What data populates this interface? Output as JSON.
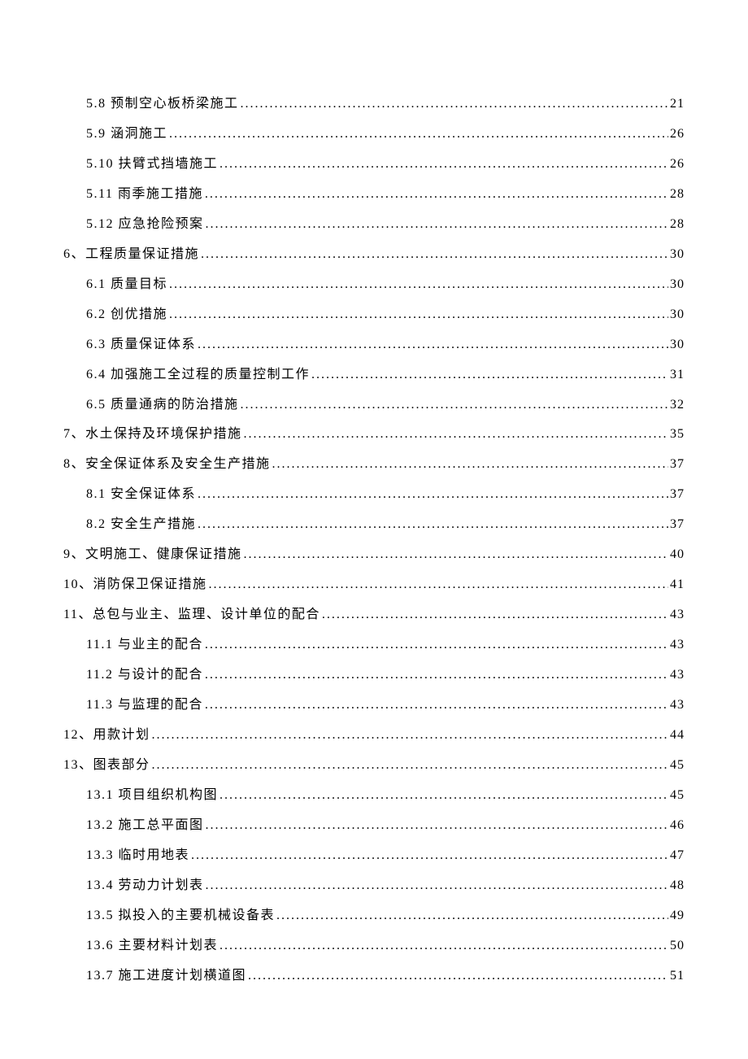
{
  "toc": [
    {
      "level": 2,
      "label": "5.8 预制空心板桥梁施工 ",
      "page": "21"
    },
    {
      "level": 2,
      "label": "5.9 涵洞施工 ",
      "page": "26"
    },
    {
      "level": 2,
      "label": "5.10 扶臂式挡墙施工 ",
      "page": "26"
    },
    {
      "level": 2,
      "label": "5.11 雨季施工措施 ",
      "page": "28"
    },
    {
      "level": 2,
      "label": "5.12 应急抢险预案 ",
      "page": "28"
    },
    {
      "level": 1,
      "label": "6、工程质量保证措施",
      "page": "30"
    },
    {
      "level": 2,
      "label": "6.1 质量目标 ",
      "page": "30"
    },
    {
      "level": 2,
      "label": "6.2 创优措施 ",
      "page": "30"
    },
    {
      "level": 2,
      "label": "6.3 质量保证体系 ",
      "page": "30"
    },
    {
      "level": 2,
      "label": "6.4 加强施工全过程的质量控制工作 ",
      "page": "31"
    },
    {
      "level": 2,
      "label": "6.5 质量通病的防治措施 ",
      "page": "32"
    },
    {
      "level": 1,
      "label": "7、水土保持及环境保护措施",
      "page": "35"
    },
    {
      "level": 1,
      "label": "8、安全保证体系及安全生产措施",
      "page": "37"
    },
    {
      "level": 2,
      "label": "8.1 安全保证体系 ",
      "page": "37"
    },
    {
      "level": 2,
      "label": "8.2 安全生产措施 ",
      "page": "37"
    },
    {
      "level": 1,
      "label": "9、文明施工、健康保证措施",
      "page": "40"
    },
    {
      "level": 1,
      "label": "10、消防保卫保证措施",
      "page": "41"
    },
    {
      "level": 1,
      "label": "11、总包与业主、监理、设计单位的配合",
      "page": "43"
    },
    {
      "level": 2,
      "label": "11.1 与业主的配合 ",
      "page": "43"
    },
    {
      "level": 2,
      "label": "11.2 与设计的配合 ",
      "page": "43"
    },
    {
      "level": 2,
      "label": "11.3  与监理的配合",
      "page": "43"
    },
    {
      "level": 1,
      "label": "12、用款计划",
      "page": "44"
    },
    {
      "level": 1,
      "label": "13、图表部分",
      "page": "45"
    },
    {
      "level": 2,
      "label": "13.1 项目组织机构图 ",
      "page": "45"
    },
    {
      "level": 2,
      "label": "13.2 施工总平面图 ",
      "page": "46"
    },
    {
      "level": 2,
      "label": "13.3 临时用地表 ",
      "page": "47"
    },
    {
      "level": 2,
      "label": "13.4 劳动力计划表 ",
      "page": "48"
    },
    {
      "level": 2,
      "label": "13.5 拟投入的主要机械设备表 ",
      "page": "49"
    },
    {
      "level": 2,
      "label": "13.6 主要材料计划表 ",
      "page": "50"
    },
    {
      "level": 2,
      "label": "13.7 施工进度计划横道图 ",
      "page": "51"
    }
  ]
}
